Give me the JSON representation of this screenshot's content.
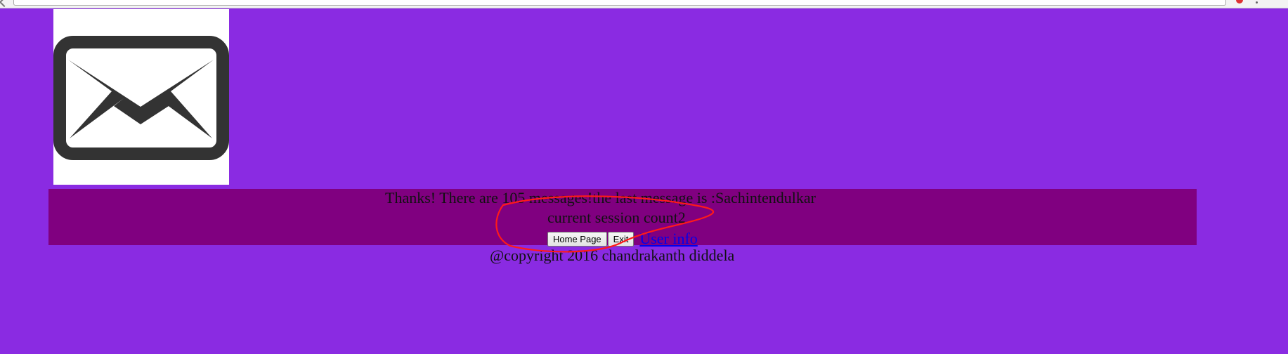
{
  "message": {
    "text": "Thanks! There are 105 messages!the last message is :Sachintendulkar"
  },
  "session": {
    "text": "current session count2"
  },
  "actions": {
    "home_label": "Home Page",
    "exit_label": "Exit",
    "link_label": "User info"
  },
  "footer": {
    "copyright": "@copyright 2016 chandrakanth diddela"
  },
  "colors": {
    "page_background": "#8a2be2",
    "panel_background": "#800080",
    "annotation": "#ff1a1a",
    "link": "#0000ee"
  },
  "icons": {
    "logo": "envelope-icon"
  }
}
